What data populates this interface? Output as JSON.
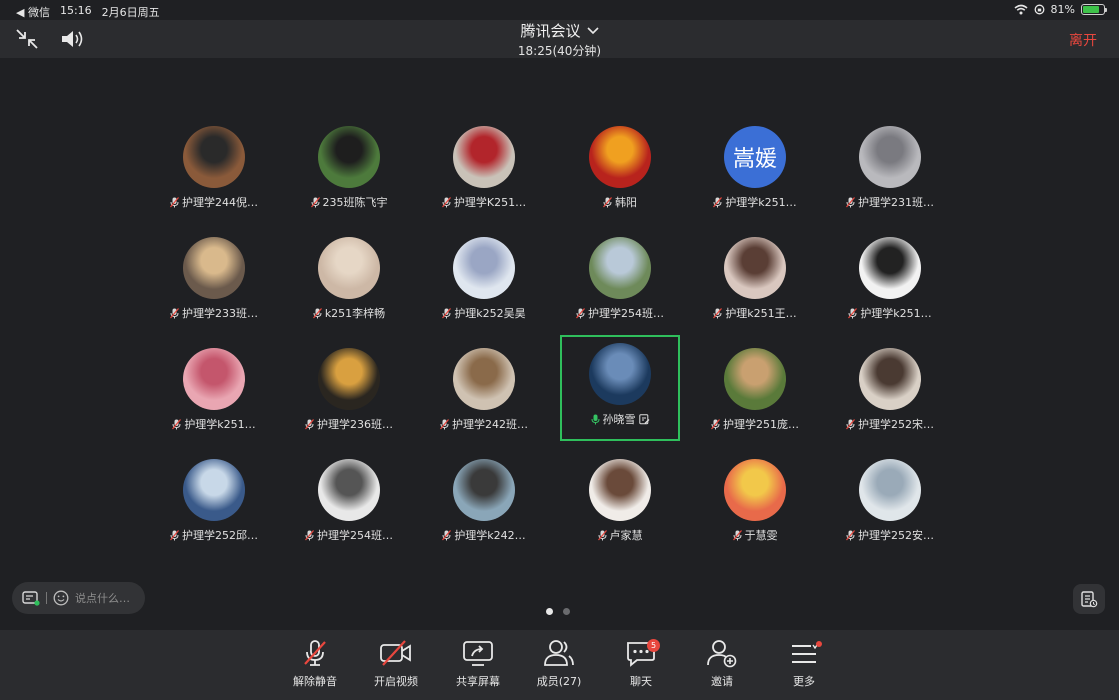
{
  "status": {
    "back_label": "◀ 微信",
    "time": "15:16",
    "date": "2月6日周五",
    "battery": "81%",
    "battery_level": 0.81
  },
  "header": {
    "title": "腾讯会议",
    "subtitle": "18:25(40分钟)",
    "leave_label": "离开"
  },
  "participants": [
    {
      "name": "护理学244倪…",
      "color": "#8a5a3a",
      "accent": "#2a2a2a"
    },
    {
      "name": "235班陈飞宇",
      "color": "#4d7a3c",
      "accent": "#1e1e1e"
    },
    {
      "name": "护理学K251…",
      "color": "#c9c2b8",
      "accent": "#b2252b"
    },
    {
      "name": "韩阳",
      "color": "#b8231d",
      "accent": "#f0a020"
    },
    {
      "name": "护理学k251…",
      "text": "嵩媛",
      "color": "#3b6fd6",
      "accent": "#3b6fd6"
    },
    {
      "name": "护理学231班…",
      "color": "#b9b9bd",
      "accent": "#7a7a80"
    },
    {
      "name": "护理学233班…",
      "color": "#6b5a4c",
      "accent": "#d9b98c"
    },
    {
      "name": "k251李梓畅",
      "color": "#cdb8a6",
      "accent": "#e6d7c6"
    },
    {
      "name": "护理k252吴昊",
      "color": "#dfe6ef",
      "accent": "#9aa6c4"
    },
    {
      "name": "护理学254班…",
      "color": "#6e8a5a",
      "accent": "#b9c9d8"
    },
    {
      "name": "护理k251王…",
      "color": "#d9c7bf",
      "accent": "#5a3e35"
    },
    {
      "name": "护理学k251…",
      "color": "#f2f2f2",
      "accent": "#222222"
    },
    {
      "name": "护理学k251…",
      "color": "#e9a6b2",
      "accent": "#c4566c"
    },
    {
      "name": "护理学236班…",
      "color": "#2a2620",
      "accent": "#d9a040"
    },
    {
      "name": "护理学242班…",
      "color": "#cfc2b2",
      "accent": "#8a6a4a"
    },
    {
      "name": "孙晓雪",
      "color": "#1c3a5e",
      "accent": "#6a8cb8",
      "active": true
    },
    {
      "name": "护理学251庞…",
      "color": "#5a7a3a",
      "accent": "#c9a070"
    },
    {
      "name": "护理学252宋…",
      "color": "#d9d0c6",
      "accent": "#4a3a32"
    },
    {
      "name": "护理学252邱…",
      "color": "#3a5a8a",
      "accent": "#c8d8e8"
    },
    {
      "name": "护理学254班…",
      "color": "#e8e8e8",
      "accent": "#555555"
    },
    {
      "name": "护理学k242…",
      "color": "#8aa6b8",
      "accent": "#3a3a3a"
    },
    {
      "name": "卢家慧",
      "color": "#f0ece8",
      "accent": "#6a4a3a"
    },
    {
      "name": "于慧雯",
      "color": "#e86a4a",
      "accent": "#f2c84a"
    },
    {
      "name": "护理学252安…",
      "color": "#e0e6ea",
      "accent": "#9aaab8"
    }
  ],
  "chat": {
    "placeholder": "说点什么…"
  },
  "pages": {
    "current": 1,
    "total": 2
  },
  "toolbar": {
    "unmute_label": "解除静音",
    "video_label": "开启视频",
    "share_label": "共享屏幕",
    "members_label": "成员(27)",
    "chat_label": "聊天",
    "chat_badge": "5",
    "invite_label": "邀请",
    "more_label": "更多"
  },
  "colors": {
    "background": "#1f2023",
    "bar": "#2b2c2f",
    "active_border": "#2fbf5c",
    "danger": "#e8473e"
  }
}
